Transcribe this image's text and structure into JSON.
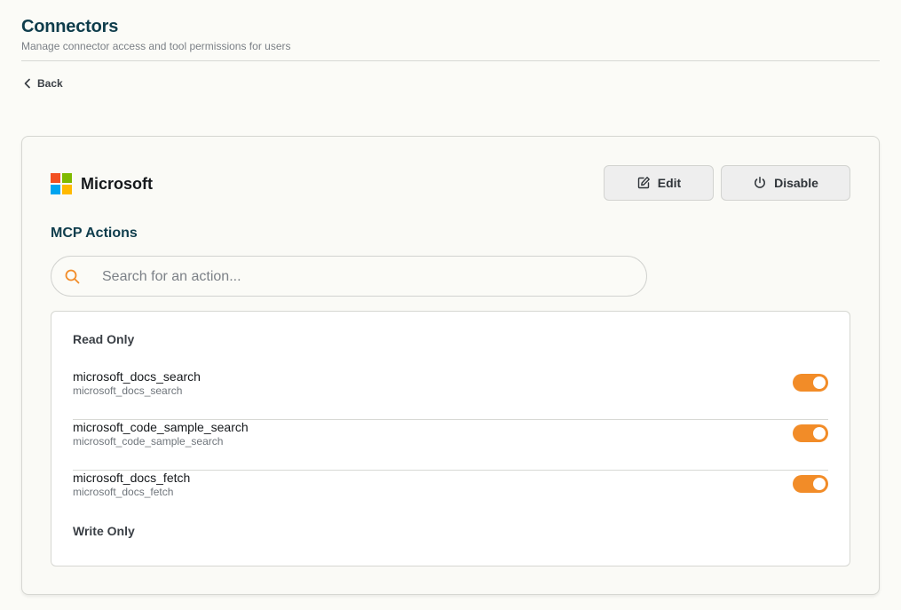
{
  "header": {
    "title": "Connectors",
    "subtitle": "Manage connector access and tool permissions for users",
    "back_label": "Back"
  },
  "connector": {
    "name": "Microsoft",
    "edit_label": "Edit",
    "disable_label": "Disable"
  },
  "mcp": {
    "section_title": "MCP Actions",
    "search_placeholder": "Search for an action...",
    "groups": [
      {
        "label": "Read Only",
        "actions": [
          {
            "name": "microsoft_docs_search",
            "id": "microsoft_docs_search",
            "enabled": true
          },
          {
            "name": "microsoft_code_sample_search",
            "id": "microsoft_code_sample_search",
            "enabled": true
          },
          {
            "name": "microsoft_docs_fetch",
            "id": "microsoft_docs_fetch",
            "enabled": true
          }
        ]
      },
      {
        "label": "Write Only",
        "actions": []
      }
    ]
  },
  "colors": {
    "title": "#0f3d4c",
    "toggle_on": "#f28c28",
    "search_icon": "#f28c28",
    "page_bg": "#fbfbf7"
  },
  "icons": {
    "back": "chevron-left-icon",
    "edit": "edit-icon",
    "disable": "power-icon",
    "search": "search-icon",
    "logo": "microsoft-logo-icon"
  }
}
